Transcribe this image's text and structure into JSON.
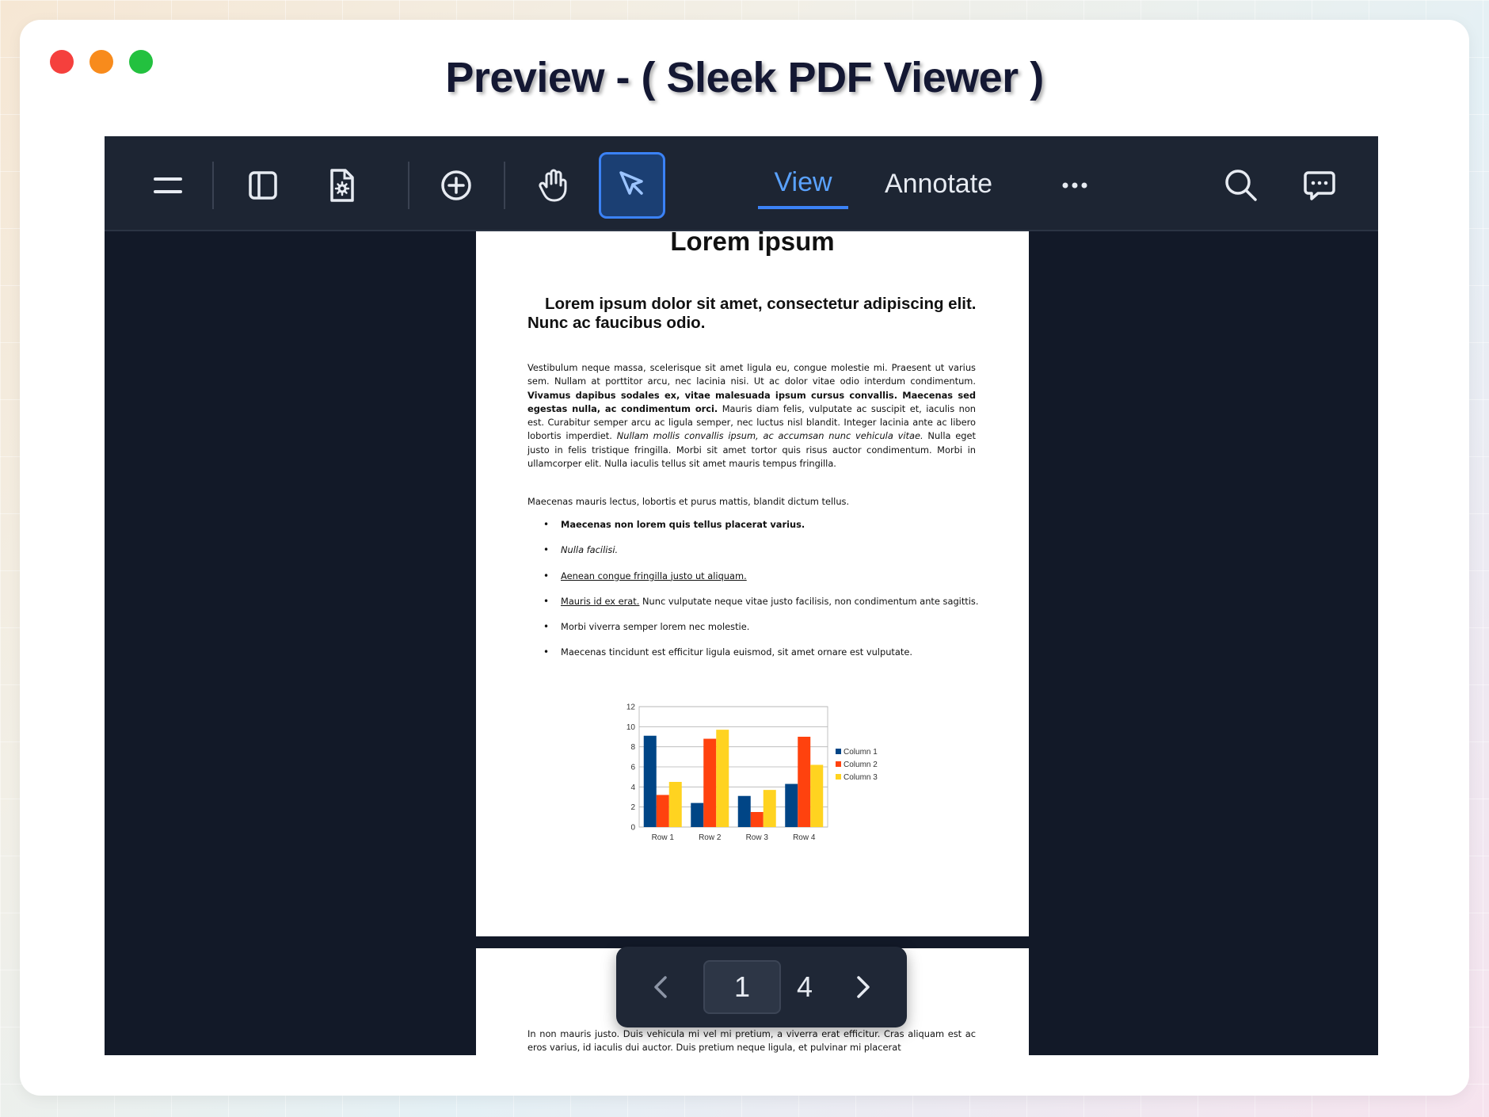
{
  "window": {
    "title": "Preview - ( Sleek PDF Viewer )"
  },
  "toolbar": {
    "tabs": [
      {
        "label": "View",
        "active": true
      },
      {
        "label": "Annotate",
        "active": false
      }
    ]
  },
  "document": {
    "page1": {
      "title": "Lorem ipsum",
      "subtitle": "Lorem ipsum dolor sit amet, consectetur adipiscing elit. Nunc ac faucibus odio.",
      "para1": {
        "a": "Vestibulum neque massa, scelerisque sit amet ligula eu, congue molestie mi. Praesent ut varius sem. Nullam at porttitor arcu, nec lacinia nisi. Ut ac dolor vitae odio interdum condimentum. ",
        "b": "Vivamus dapibus sodales ex, vitae malesuada ipsum cursus convallis. Maecenas sed egestas nulla, ac condimentum orci.",
        "c": " Mauris diam felis, vulputate ac suscipit et, iaculis non est. Curabitur semper arcu ac ligula semper, nec luctus nisl blandit. Integer lacinia ante ac libero lobortis imperdiet. ",
        "d": "Nullam mollis convallis ipsum, ac accumsan nunc vehicula vitae.",
        "e": " Nulla eget justo in felis tristique fringilla. Morbi sit amet tortor quis risus auctor condimentum. Morbi in ullamcorper elit. Nulla iaculis tellus sit amet mauris tempus fringilla."
      },
      "para2": "Maecenas mauris lectus, lobortis et purus mattis, blandit dictum tellus.",
      "bullets": {
        "b1": "Maecenas non lorem quis tellus placerat varius.",
        "b2": "Nulla facilisi.",
        "b3": "Aenean congue fringilla justo ut aliquam.",
        "b4_link": "Mauris id ex erat.",
        "b4_rest": " Nunc vulputate neque vitae justo facilisis, non condimentum ante sagittis.",
        "b5": "Morbi viverra semper lorem nec molestie.",
        "b6": "Maecenas tincidunt est efficitur ligula euismod, sit amet ornare est vulputate."
      }
    },
    "page2": {
      "para": "In non mauris justo. Duis vehicula mi vel mi pretium, a viverra erat efficitur. Cras aliquam est ac eros varius, id iaculis dui auctor. Duis pretium neque ligula, et pulvinar mi placerat"
    }
  },
  "chart_data": {
    "type": "bar",
    "categories": [
      "Row 1",
      "Row 2",
      "Row 3",
      "Row 4"
    ],
    "series": [
      {
        "name": "Column 1",
        "color": "#004586",
        "values": [
          9.1,
          2.4,
          3.1,
          4.3
        ]
      },
      {
        "name": "Column 2",
        "color": "#ff420e",
        "values": [
          3.2,
          8.8,
          1.5,
          9.0
        ]
      },
      {
        "name": "Column 3",
        "color": "#ffd320",
        "values": [
          4.5,
          9.7,
          3.7,
          6.2
        ]
      }
    ],
    "yticks": [
      0,
      2,
      4,
      6,
      8,
      10,
      12
    ],
    "ylim": [
      0,
      12
    ],
    "grid": true,
    "legend": "right"
  },
  "pager": {
    "current": "1",
    "total": "4"
  },
  "colors": {
    "accent": "#3b82f6",
    "viewer_bg": "#121928",
    "toolbar_bg": "#1d2533"
  },
  "icons": [
    "menu-icon",
    "sidebar-icon",
    "file-settings-icon",
    "zoom-in-icon",
    "hand-icon",
    "pointer-icon",
    "more-icon",
    "search-icon",
    "comment-icon",
    "chevron-left-icon",
    "chevron-right-icon"
  ]
}
